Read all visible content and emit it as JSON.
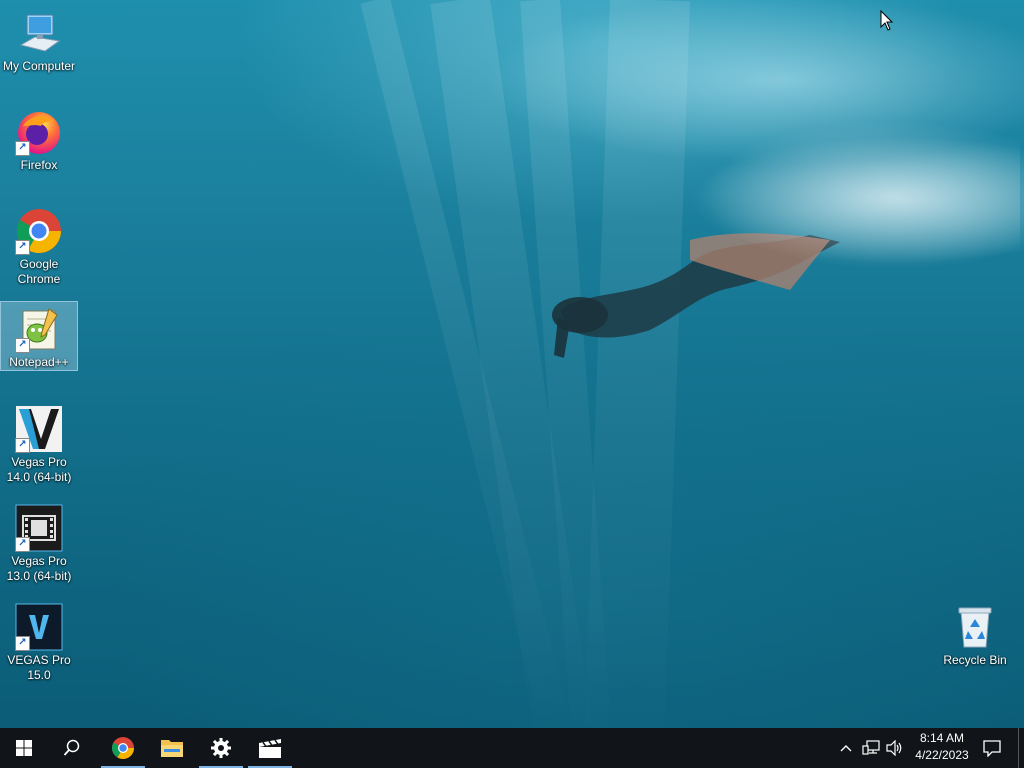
{
  "desktop": {
    "icons": [
      {
        "label": "My Computer",
        "icon": "computer-icon"
      },
      {
        "label": "Firefox",
        "icon": "firefox-icon"
      },
      {
        "label": "Google Chrome",
        "icon": "chrome-icon"
      },
      {
        "label": "Notepad++",
        "icon": "notepadpp-icon"
      },
      {
        "label": "Vegas Pro 14.0 (64-bit)",
        "icon": "vegas-14-icon"
      },
      {
        "label": "Vegas Pro 13.0 (64-bit)",
        "icon": "vegas-13-icon"
      },
      {
        "label": "VEGAS Pro 15.0",
        "icon": "vegas-15-icon"
      }
    ],
    "recycle_bin": {
      "label": "Recycle Bin",
      "icon": "recycle-bin-icon"
    }
  },
  "taskbar": {
    "buttons": [
      {
        "name": "start",
        "icon": "windows-start-icon"
      },
      {
        "name": "search",
        "icon": "search-icon"
      },
      {
        "name": "chrome",
        "icon": "chrome-icon",
        "active": true
      },
      {
        "name": "file-explorer",
        "icon": "folder-icon"
      },
      {
        "name": "settings",
        "icon": "gear-icon",
        "active": true
      },
      {
        "name": "media",
        "icon": "clapperboard-icon",
        "active": true
      }
    ],
    "tray": {
      "chevron_icon": "chevron-up-icon",
      "network_icon": "network-icon",
      "volume_icon": "speaker-icon",
      "notification_icon": "action-center-icon"
    },
    "clock": {
      "time": "8:14 AM",
      "date": "4/22/2023"
    }
  },
  "colors": {
    "taskbar": "#111418",
    "accent": "#7fb4e6",
    "water": "#1a7f9c"
  }
}
